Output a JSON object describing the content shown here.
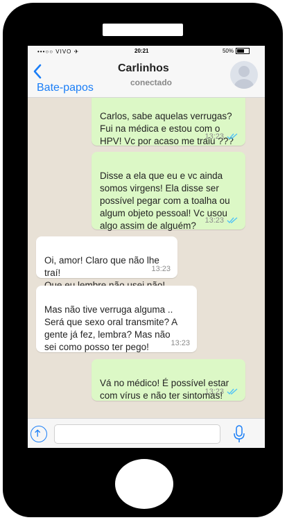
{
  "status_bar": {
    "carrier": "•••○○ VIVO ✈",
    "time": "20:21",
    "battery": "50%"
  },
  "header": {
    "back_label": "Bate-papos",
    "contact_name": "Carlinhos",
    "contact_status": "conectado"
  },
  "messages": [
    {
      "direction": "out",
      "text": "Carlos, sabe aquelas verrugas?\nFui na médica e estou com o\nHPV! Vc por acaso me traiu ???",
      "time": "13:23",
      "read": true
    },
    {
      "direction": "out",
      "text": "Disse a ela que eu e vc ainda\nsomos virgens! Ela disse ser\npossível pegar com a toalha ou\nalgum objeto pessoal! Vc usou\nalgo assim de alguém?",
      "time": "13:23",
      "read": true
    },
    {
      "direction": "in",
      "text": "Oi, amor! Claro que não lhe traí!\nQue eu lembre não usei não!",
      "time": "13:23"
    },
    {
      "direction": "in",
      "text": "Mas não tive verruga alguma ..\nSerá que sexo oral transmite? A\ngente já fez, lembra? Mas não\nsei como posso ter pego!",
      "time": "13:23"
    },
    {
      "direction": "out",
      "text": "Vá no médico! É possível estar\ncom vírus e não ter sintomas!",
      "time": "13:23",
      "read": true
    }
  ],
  "composer": {
    "placeholder": ""
  },
  "colors": {
    "outgoing": "#dcf8c6",
    "incoming": "#ffffff",
    "accent": "#1a7ef7",
    "read_ticks": "#4fc3f7"
  }
}
